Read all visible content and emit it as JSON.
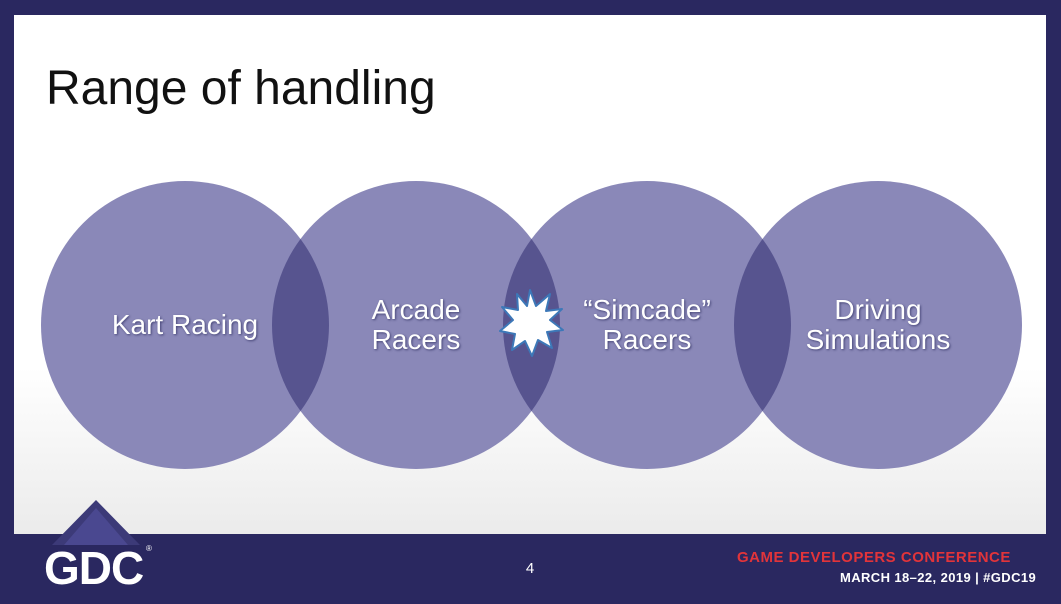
{
  "slide": {
    "title": "Range of handling",
    "circles": [
      {
        "line1": "Kart Racing",
        "line2": ""
      },
      {
        "line1": "Arcade",
        "line2": "Racers"
      },
      {
        "line1": "“Simcade”",
        "line2": "Racers"
      },
      {
        "line1": "Driving",
        "line2": "Simulations"
      }
    ],
    "colors": {
      "circle": "#8a88b8",
      "overlap": "#57548f",
      "star": "#ffffff",
      "star_outline": "#3d78b8"
    }
  },
  "footer": {
    "page_number": "4",
    "logo": "GDC",
    "conference_name": "GAME DEVELOPERS CONFERENCE",
    "conference_dates": "MARCH 18–22, 2019  |  #GDC19",
    "colors": {
      "background": "#2a2860",
      "accent": "#e2343a"
    }
  }
}
